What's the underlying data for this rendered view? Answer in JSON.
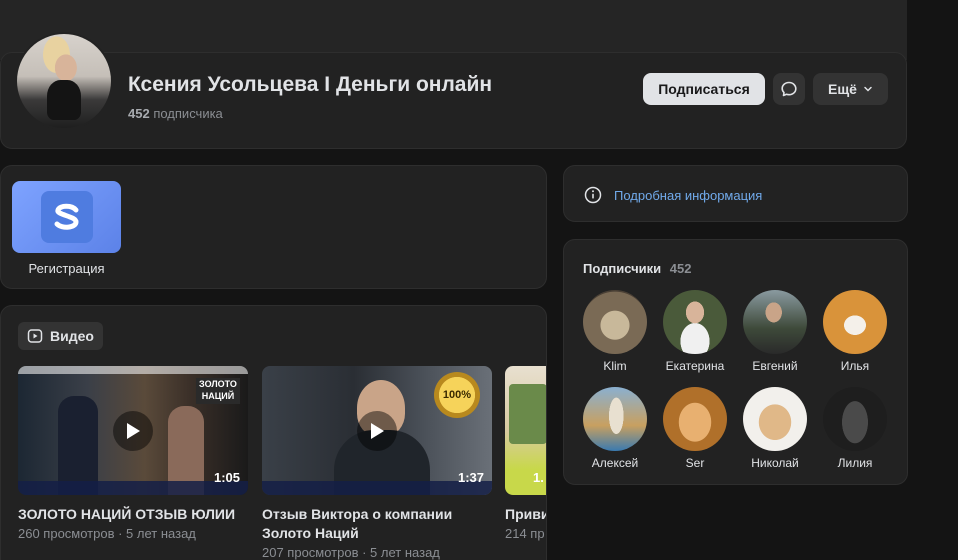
{
  "profile": {
    "name": "Ксения Усольцева I Деньги онлайн",
    "subscribers_count": "452",
    "subscribers_word": "подписчика",
    "subscribe_label": "Подписаться",
    "more_label": "Ещё"
  },
  "links": {
    "items": [
      {
        "label": "Регистрация"
      }
    ]
  },
  "videos": {
    "section_label": "Видео",
    "items": [
      {
        "title": "ЗОЛОТО НАЦИЙ ОТЗЫВ ЮЛИИ",
        "meta": "260 просмотров · 5 лет назад",
        "duration": "1:05"
      },
      {
        "title": "Отзыв Виктора о компании Золото Наций",
        "meta": "207 просмотров · 5 лет назад",
        "duration": "1:37"
      },
      {
        "title": "Приви",
        "meta": "214 пр",
        "duration": "1."
      }
    ]
  },
  "info": {
    "label": "Подробная информация"
  },
  "subscribers": {
    "title": "Подписчики",
    "count": "452",
    "items": [
      {
        "name": "Klim",
        "color": "#7a6a55"
      },
      {
        "name": "Екатерина",
        "color": "#4a5a3a"
      },
      {
        "name": "Евгений",
        "color": "#3e4a3a"
      },
      {
        "name": "Илья",
        "color": "#d9b38a"
      },
      {
        "name": "Алексей",
        "color": "#6a8aa8"
      },
      {
        "name": "Ser",
        "color": "#d49a4a"
      },
      {
        "name": "Николай",
        "color": "#d8b48a"
      },
      {
        "name": "Лилия",
        "color": "#2a2a2a"
      }
    ]
  },
  "colors": {
    "background": "#141414",
    "card": "#222222",
    "accent_link": "#71aaeb",
    "subscribe_button": "#e1e3e6"
  }
}
